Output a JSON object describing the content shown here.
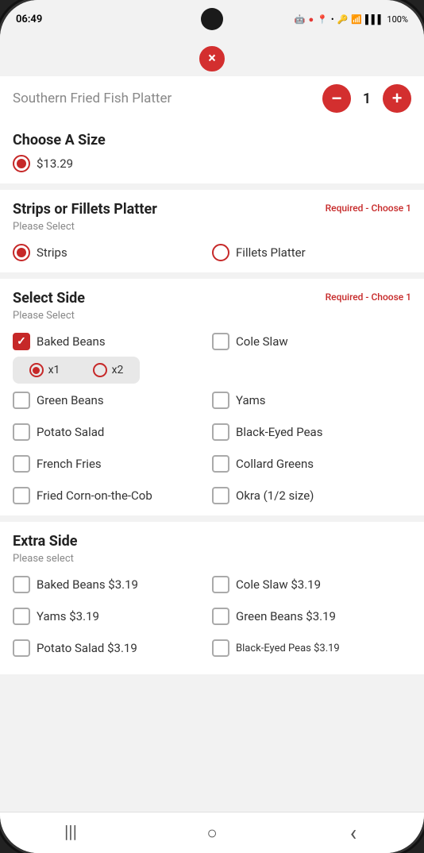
{
  "status_bar": {
    "time": "06:49",
    "battery": "100%",
    "signal": "●●●",
    "wifi": "WiFi"
  },
  "close_button": {
    "label": "×"
  },
  "item_header": {
    "title": "Southern Fried Fish Platter",
    "quantity": "1"
  },
  "controls": {
    "minus": "−",
    "plus": "+"
  },
  "size_section": {
    "title": "Choose A Size",
    "options": [
      {
        "label": "$13.29",
        "checked": true
      }
    ]
  },
  "platter_section": {
    "title": "Strips or Fillets Platter",
    "required": "Required - Choose 1",
    "please_select": "Please Select",
    "options": [
      {
        "label": "Strips",
        "checked": true
      },
      {
        "label": "Fillets Platter",
        "checked": false
      }
    ]
  },
  "side_section": {
    "title": "Select Side",
    "required": "Required - Choose 1",
    "please_select": "Please Select",
    "options": [
      {
        "label": "Baked Beans",
        "checked": true,
        "has_qty": true,
        "qty_x1": true,
        "qty_x2": false
      },
      {
        "label": "Cole Slaw",
        "checked": false
      },
      {
        "label": "Green Beans",
        "checked": false
      },
      {
        "label": "Yams",
        "checked": false
      },
      {
        "label": "Potato Salad",
        "checked": false
      },
      {
        "label": "Black-Eyed Peas",
        "checked": false
      },
      {
        "label": "French Fries",
        "checked": false
      },
      {
        "label": "Collard Greens",
        "checked": false
      },
      {
        "label": "Fried Corn-on-the-Cob",
        "checked": false
      },
      {
        "label": "Okra (1/2 size)",
        "checked": false
      }
    ],
    "qty_x1_label": "x1",
    "qty_x2_label": "x2"
  },
  "extra_side_section": {
    "title": "Extra Side",
    "please_select": "Please select",
    "options": [
      {
        "label": "Baked Beans $3.19",
        "checked": false
      },
      {
        "label": "Cole Slaw $3.19",
        "checked": false
      },
      {
        "label": "Yams $3.19",
        "checked": false
      },
      {
        "label": "Green Beans $3.19",
        "checked": false
      },
      {
        "label": "Potato Salad $3.19",
        "checked": false
      },
      {
        "label": "Black-Eyed Peas $3.19",
        "checked": false
      }
    ]
  },
  "nav": {
    "menu": "|||",
    "home": "○",
    "back": "‹"
  }
}
